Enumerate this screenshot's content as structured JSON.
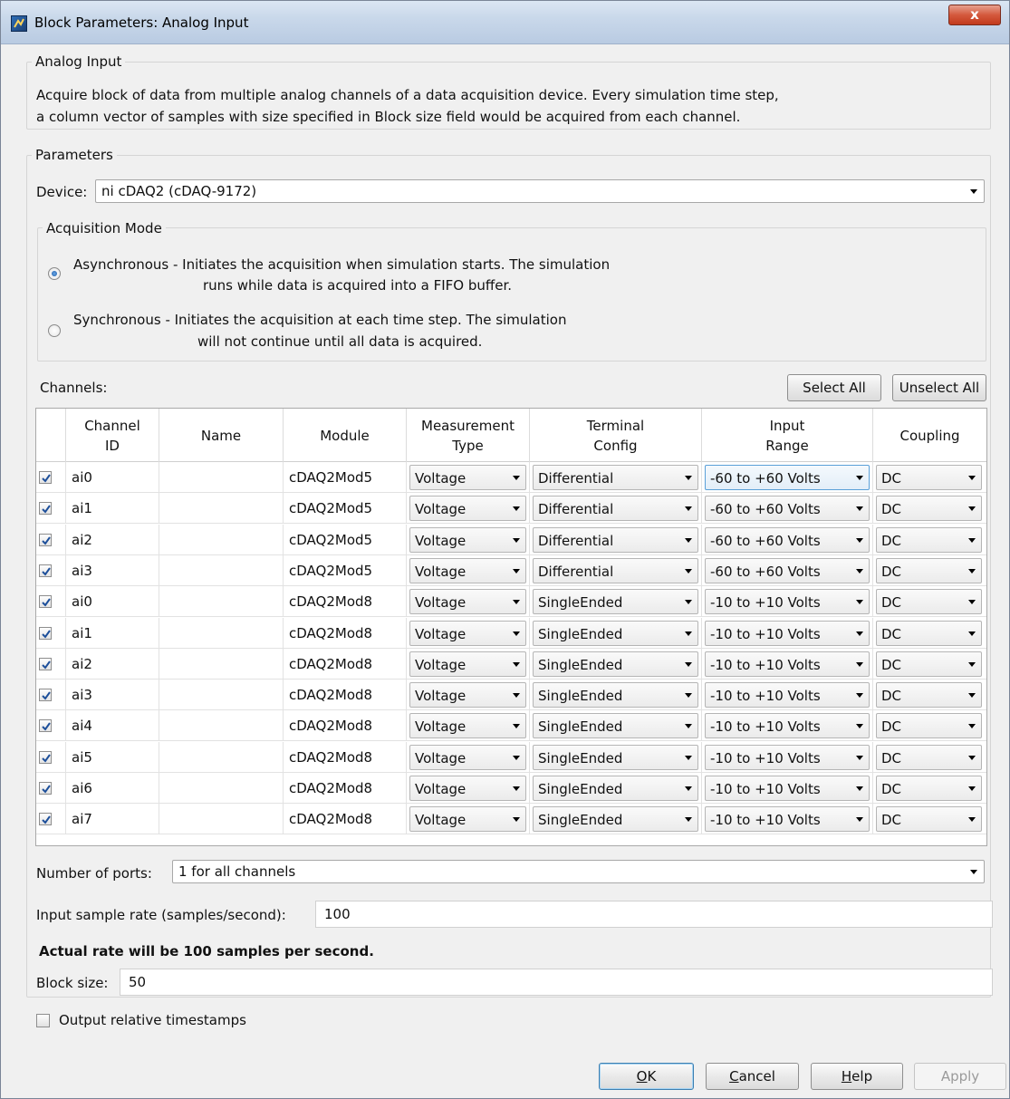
{
  "window": {
    "title": "Block Parameters: Analog Input",
    "close_glyph": "x"
  },
  "analog_input": {
    "group_label": "Analog Input",
    "description_line1": "Acquire block of data from multiple analog channels of a data acquisition device. Every simulation time step,",
    "description_line2": "a column vector of samples with size specified in Block size field would be acquired from each channel."
  },
  "parameters": {
    "group_label": "Parameters",
    "device_label": "Device:",
    "device_value": "ni cDAQ2 (cDAQ-9172)",
    "acquisition_mode": {
      "group_label": "Acquisition Mode",
      "async_line1": "Asynchronous - Initiates the acquisition when simulation starts. The simulation",
      "async_line2": "runs while data is acquired into a FIFO buffer.",
      "sync_line1": "Synchronous  - Initiates the acquisition at each time step. The simulation",
      "sync_line2": "will not continue until all data is acquired.",
      "selected": "Asynchronous"
    },
    "channels_label": "Channels:",
    "select_all": "Select All",
    "unselect_all": "Unselect All",
    "columns": {
      "channel_id_1": "Channel",
      "channel_id_2": "ID",
      "name": "Name",
      "module": "Module",
      "measurement_1": "Measurement",
      "measurement_2": "Type",
      "terminal_1": "Terminal",
      "terminal_2": "Config",
      "range_1": "Input",
      "range_2": "Range",
      "coupling": "Coupling"
    },
    "rows": [
      {
        "checked": true,
        "id": "ai0",
        "name": "",
        "module": "cDAQ2Mod5",
        "type": "Voltage",
        "terminal": "Differential",
        "range": "-60 to +60 Volts",
        "coupling": "DC"
      },
      {
        "checked": true,
        "id": "ai1",
        "name": "",
        "module": "cDAQ2Mod5",
        "type": "Voltage",
        "terminal": "Differential",
        "range": "-60 to +60 Volts",
        "coupling": "DC"
      },
      {
        "checked": true,
        "id": "ai2",
        "name": "",
        "module": "cDAQ2Mod5",
        "type": "Voltage",
        "terminal": "Differential",
        "range": "-60 to +60 Volts",
        "coupling": "DC"
      },
      {
        "checked": true,
        "id": "ai3",
        "name": "",
        "module": "cDAQ2Mod5",
        "type": "Voltage",
        "terminal": "Differential",
        "range": "-60 to +60 Volts",
        "coupling": "DC"
      },
      {
        "checked": true,
        "id": "ai0",
        "name": "",
        "module": "cDAQ2Mod8",
        "type": "Voltage",
        "terminal": "SingleEnded",
        "range": "-10 to +10 Volts",
        "coupling": "DC"
      },
      {
        "checked": true,
        "id": "ai1",
        "name": "",
        "module": "cDAQ2Mod8",
        "type": "Voltage",
        "terminal": "SingleEnded",
        "range": "-10 to +10 Volts",
        "coupling": "DC"
      },
      {
        "checked": true,
        "id": "ai2",
        "name": "",
        "module": "cDAQ2Mod8",
        "type": "Voltage",
        "terminal": "SingleEnded",
        "range": "-10 to +10 Volts",
        "coupling": "DC"
      },
      {
        "checked": true,
        "id": "ai3",
        "name": "",
        "module": "cDAQ2Mod8",
        "type": "Voltage",
        "terminal": "SingleEnded",
        "range": "-10 to +10 Volts",
        "coupling": "DC"
      },
      {
        "checked": true,
        "id": "ai4",
        "name": "",
        "module": "cDAQ2Mod8",
        "type": "Voltage",
        "terminal": "SingleEnded",
        "range": "-10 to +10 Volts",
        "coupling": "DC"
      },
      {
        "checked": true,
        "id": "ai5",
        "name": "",
        "module": "cDAQ2Mod8",
        "type": "Voltage",
        "terminal": "SingleEnded",
        "range": "-10 to +10 Volts",
        "coupling": "DC"
      },
      {
        "checked": true,
        "id": "ai6",
        "name": "",
        "module": "cDAQ2Mod8",
        "type": "Voltage",
        "terminal": "SingleEnded",
        "range": "-10 to +10 Volts",
        "coupling": "DC"
      },
      {
        "checked": true,
        "id": "ai7",
        "name": "",
        "module": "cDAQ2Mod8",
        "type": "Voltage",
        "terminal": "SingleEnded",
        "range": "-10 to +10 Volts",
        "coupling": "DC"
      }
    ],
    "ports_label": "Number of ports:",
    "ports_value": "1 for all channels",
    "rate_label": "Input sample rate (samples/second):",
    "rate_value": "100",
    "actual_rate": "Actual rate will be 100 samples per second.",
    "block_size_label": "Block size:",
    "block_size_value": "50",
    "timestamps_label": "Output relative timestamps",
    "timestamps_checked": false
  },
  "buttons": {
    "ok_u": "O",
    "ok_rest": "K",
    "cancel_u": "C",
    "cancel_rest": "ancel",
    "help_u": "H",
    "help_rest": "elp",
    "apply": "Apply"
  },
  "colors": {
    "accent": "#3c7fb1",
    "close": "#c23a1c"
  }
}
